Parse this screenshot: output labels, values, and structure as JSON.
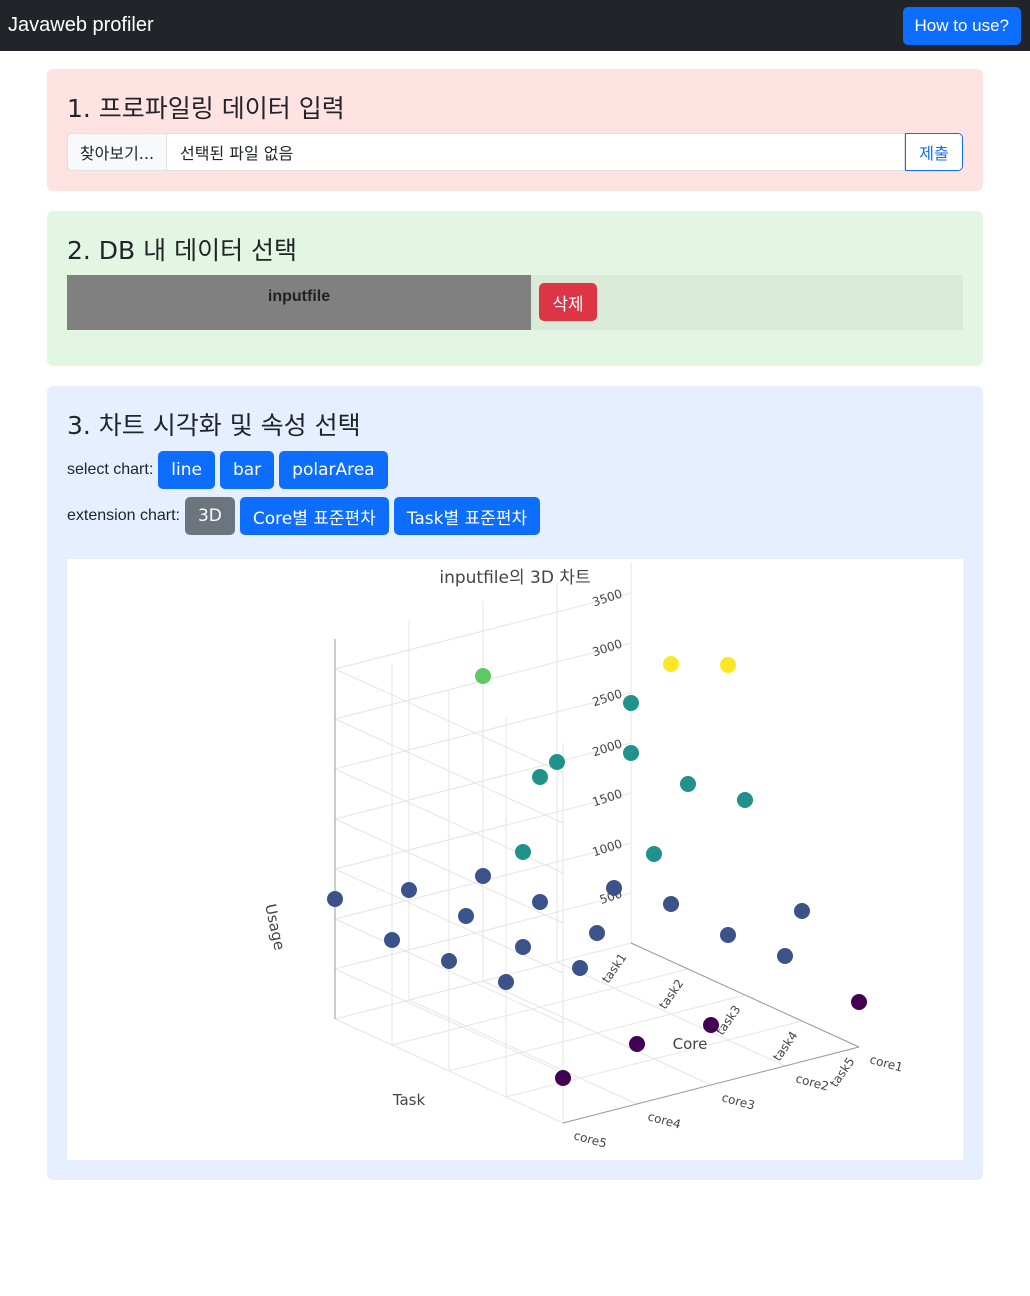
{
  "navbar": {
    "brand": "Javaweb profiler",
    "help_button": "How to use?"
  },
  "section1": {
    "title": "1. 프로파일링 데이터 입력",
    "browse_label": "찾아보기...",
    "file_name": "선택된 파일 없음",
    "submit_label": "제출"
  },
  "section2": {
    "title": "2. DB 내 데이터 선택",
    "items": [
      {
        "name": "inputfile",
        "delete_label": "삭제"
      }
    ]
  },
  "section3": {
    "title": "3. 차트 시각화 및 속성 선택",
    "select_label": "select chart:",
    "chart_buttons": [
      "line",
      "bar",
      "polarArea"
    ],
    "extension_label": "extension chart:",
    "extension_buttons": [
      "3D",
      "Core별 표준편차",
      "Task별 표준편차"
    ],
    "active_extension": "3D"
  },
  "chart_data": {
    "type": "scatter",
    "title": "inputfile의 3D 차트",
    "xlabel": "Task",
    "ylabel": "Core",
    "zlabel": "Usage",
    "x_categories": [
      "task1",
      "task2",
      "task3",
      "task4",
      "task5"
    ],
    "y_categories": [
      "core1",
      "core2",
      "core3",
      "core4",
      "core5"
    ],
    "z_ticks": [
      500,
      1000,
      1500,
      2000,
      2500,
      3000,
      3500
    ],
    "colorscale": [
      "#440154",
      "#3b528b",
      "#21918c",
      "#5ec962",
      "#fde725"
    ],
    "points": [
      {
        "task": "task1",
        "core": "core1",
        "usage": 1900
      },
      {
        "task": "task1",
        "core": "core2",
        "usage": 2000
      },
      {
        "task": "task1",
        "core": "core3",
        "usage": 1050
      },
      {
        "task": "task1",
        "core": "core4",
        "usage": 1100
      },
      {
        "task": "task1",
        "core": "core5",
        "usage": 1200
      },
      {
        "task": "task2",
        "core": "core1",
        "usage": 1850
      },
      {
        "task": "task2",
        "core": "core2",
        "usage": 1000
      },
      {
        "task": "task2",
        "core": "core3",
        "usage": 1050
      },
      {
        "task": "task2",
        "core": "core4",
        "usage": 1100
      },
      {
        "task": "task2",
        "core": "core5",
        "usage": 1050
      },
      {
        "task": "task3",
        "core": "core1",
        "usage": 1950
      },
      {
        "task": "task3",
        "core": "core2",
        "usage": 1100
      },
      {
        "task": "task3",
        "core": "core3",
        "usage": 1000
      },
      {
        "task": "task3",
        "core": "core4",
        "usage": 1050
      },
      {
        "task": "task3",
        "core": "core5",
        "usage": 1100
      },
      {
        "task": "task4",
        "core": "core1",
        "usage": 1100
      },
      {
        "task": "task4",
        "core": "core2",
        "usage": 1050
      },
      {
        "task": "task4",
        "core": "core3",
        "usage": 2050
      },
      {
        "task": "task4",
        "core": "core4",
        "usage": 1100
      },
      {
        "task": "task4",
        "core": "core5",
        "usage": 1150
      },
      {
        "task": "task5",
        "core": "core1",
        "usage": 450
      },
      {
        "task": "task5",
        "core": "core2",
        "usage": 1100
      },
      {
        "task": "task5",
        "core": "core3",
        "usage": 600
      },
      {
        "task": "task5",
        "core": "core4",
        "usage": 600
      },
      {
        "task": "task5",
        "core": "core5",
        "usage": 450
      },
      {
        "task": "task1",
        "core": "core1",
        "usage": 2400
      },
      {
        "task": "task1",
        "core": "core3",
        "usage": 3050
      },
      {
        "task": "task3",
        "core": "core2",
        "usage": 3500
      },
      {
        "task": "task4",
        "core": "core2",
        "usage": 3750
      },
      {
        "task": "task2",
        "core": "core3",
        "usage": 2300
      },
      {
        "task": "task3",
        "core": "core4",
        "usage": 2000
      }
    ]
  }
}
